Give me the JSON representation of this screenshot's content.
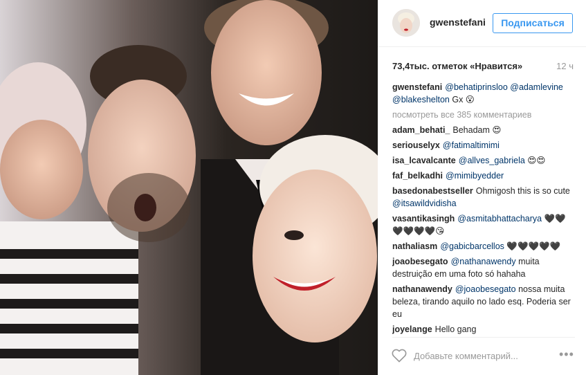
{
  "post": {
    "photo_alt": "",
    "colors": {
      "accent": "#3897f0",
      "mention": "#003569",
      "muted": "#999999"
    }
  },
  "header": {
    "username": "gwenstefani",
    "follow_label": "Подписаться"
  },
  "meta": {
    "likes": "73,4тыс. отметок «Нравится»",
    "time": "12 ч"
  },
  "caption": {
    "user": "gwenstefani",
    "parts": [
      {
        "t": "@behatiprinsloo",
        "m": true
      },
      {
        "t": " ",
        "m": false
      },
      {
        "t": "@adamlevine",
        "m": true
      },
      {
        "t": " ",
        "m": false
      },
      {
        "t": "@blakeshelton",
        "m": true
      },
      {
        "t": " Gx 😮",
        "m": false
      }
    ]
  },
  "view_all": "посмотреть все 385 комментариев",
  "comments": [
    {
      "user": "adam_behati_",
      "parts": [
        {
          "t": "Behadam 😍",
          "m": false
        }
      ]
    },
    {
      "user": "seriouselyx",
      "parts": [
        {
          "t": "@fatimaltimimi",
          "m": true
        }
      ]
    },
    {
      "user": "isa_lcavalcante",
      "parts": [
        {
          "t": "@allves_gabriela",
          "m": true
        },
        {
          "t": " 😍😍",
          "m": false
        }
      ]
    },
    {
      "user": "faf_belkadhi",
      "parts": [
        {
          "t": "@mimibyedder",
          "m": true
        }
      ]
    },
    {
      "user": "basedonabestseller",
      "parts": [
        {
          "t": "Ohmigosh this is so cute ",
          "m": false
        },
        {
          "t": "@itsawildvidisha",
          "m": true
        }
      ]
    },
    {
      "user": "vasantikasingh",
      "parts": [
        {
          "t": "@asmitabhattacharya",
          "m": true
        },
        {
          "t": " 🖤🖤🖤🖤🖤🖤😘",
          "m": false
        }
      ]
    },
    {
      "user": "nathaliasm",
      "parts": [
        {
          "t": "@gabicbarcellos",
          "m": true
        },
        {
          "t": " 🖤🖤🖤🖤🖤",
          "m": false
        }
      ]
    },
    {
      "user": "joaobesegato",
      "parts": [
        {
          "t": "@nathanawendy",
          "m": true
        },
        {
          "t": " muita destruição em uma foto só hahaha",
          "m": false
        }
      ]
    },
    {
      "user": "nathanawendy",
      "parts": [
        {
          "t": "@joaobesegato",
          "m": true
        },
        {
          "t": " nossa muita beleza, tirando aquilo no lado esq. Poderia ser eu",
          "m": false
        }
      ]
    },
    {
      "user": "joyelange",
      "parts": [
        {
          "t": "Hello gang",
          "m": false
        }
      ]
    }
  ],
  "add_comment": {
    "placeholder": "Добавьте комментарий...",
    "more_label": "•••"
  }
}
